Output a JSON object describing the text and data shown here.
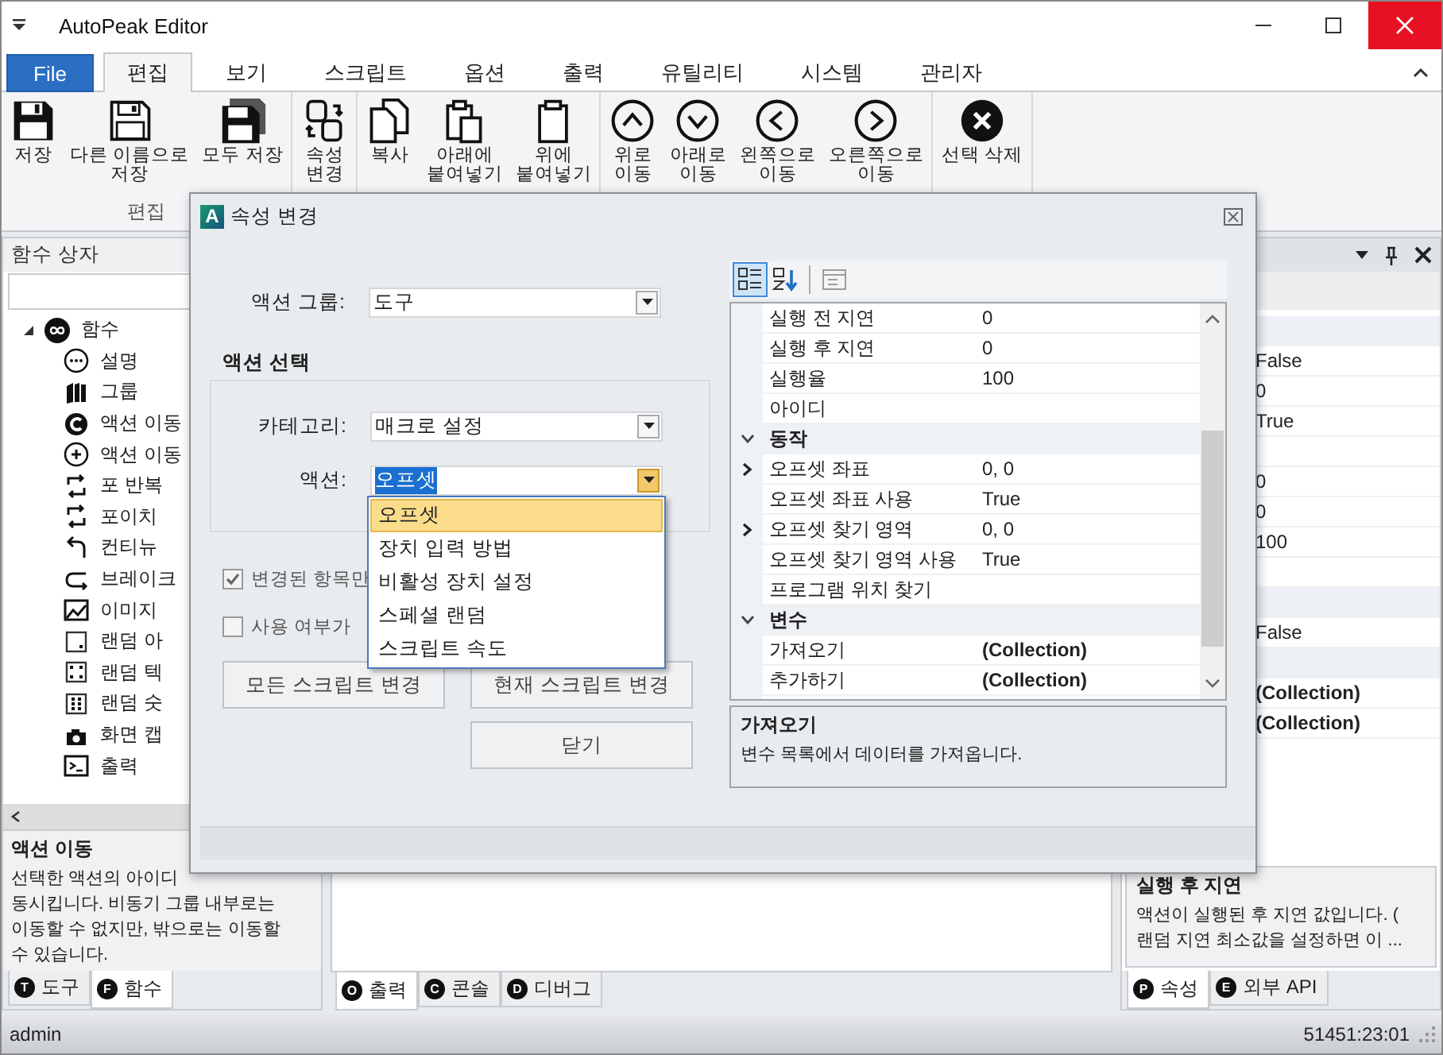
{
  "window": {
    "title": "AutoPeak Editor"
  },
  "ribbon_tabs": [
    {
      "label": "File",
      "kind": "file",
      "selected": false
    },
    {
      "label": "편집",
      "kind": "tab",
      "selected": true
    },
    {
      "label": "보기",
      "kind": "tab",
      "selected": false
    },
    {
      "label": "스크립트",
      "kind": "tab",
      "selected": false
    },
    {
      "label": "옵션",
      "kind": "tab",
      "selected": false
    },
    {
      "label": "출력",
      "kind": "tab",
      "selected": false
    },
    {
      "label": "유틸리티",
      "kind": "tab",
      "selected": false
    },
    {
      "label": "시스템",
      "kind": "tab",
      "selected": false
    },
    {
      "label": "관리자",
      "kind": "tab",
      "selected": false
    }
  ],
  "ribbon_groups": [
    {
      "label": "편집",
      "buttons": [
        {
          "kind": "save",
          "lines": [
            "저장"
          ]
        },
        {
          "kind": "save-as",
          "lines": [
            "다른 이름으로",
            "저장"
          ]
        },
        {
          "kind": "save-all",
          "lines": [
            "모두 저장"
          ]
        }
      ]
    },
    {
      "buttons": [
        {
          "kind": "swap",
          "lines": [
            "속성",
            "변경"
          ]
        }
      ]
    },
    {
      "buttons": [
        {
          "kind": "copy",
          "lines": [
            "복사"
          ]
        },
        {
          "kind": "paste-below",
          "lines": [
            "아래에",
            "붙여넣기"
          ]
        },
        {
          "kind": "paste-above",
          "lines": [
            "위에",
            "붙여넣기"
          ]
        }
      ]
    },
    {
      "buttons": [
        {
          "kind": "up",
          "lines": [
            "위로",
            "이동"
          ]
        },
        {
          "kind": "down",
          "lines": [
            "아래로",
            "이동"
          ]
        },
        {
          "kind": "left",
          "lines": [
            "왼쪽으로",
            "이동"
          ]
        },
        {
          "kind": "right",
          "lines": [
            "오른쪽으로",
            "이동"
          ]
        }
      ]
    },
    {
      "buttons": [
        {
          "kind": "delete",
          "lines": [
            "선택 삭제"
          ]
        }
      ]
    }
  ],
  "left_panel": {
    "title": "함수 상자",
    "tree": [
      {
        "label": "함수",
        "kind": "infinity",
        "expanded": true,
        "children": [
          {
            "label": "설명",
            "kind": "dots"
          },
          {
            "label": "그룹",
            "kind": "books"
          },
          {
            "label": "액션 이동",
            "kind": "c-filled"
          },
          {
            "label": "액션 이동",
            "kind": "plus-circle"
          },
          {
            "label": "포 반복",
            "kind": "loop"
          },
          {
            "label": "포이치",
            "kind": "loop"
          },
          {
            "label": "컨티뉴",
            "kind": "return"
          },
          {
            "label": "브레이크",
            "kind": "break"
          },
          {
            "label": "이미지",
            "kind": "image"
          },
          {
            "label": "랜덤 아",
            "kind": "dice-one"
          },
          {
            "label": "랜덤 텍",
            "kind": "dice-four"
          },
          {
            "label": "랜덤 숫",
            "kind": "dice-six"
          },
          {
            "label": "화면 캡",
            "kind": "camera"
          },
          {
            "label": "출력",
            "kind": "terminal"
          }
        ]
      }
    ],
    "description": {
      "title": "액션 이동",
      "lines": [
        "선택한 액션의 아이디",
        "동시킵니다. 비동기 그룹 내부로는",
        "이동할 수 없지만, 밖으로는 이동할",
        "수 있습니다."
      ]
    },
    "tabs": [
      {
        "letter": "T",
        "label": "도구",
        "selected": false
      },
      {
        "letter": "F",
        "label": "함수",
        "selected": true
      }
    ]
  },
  "center_panel": {
    "tabs": [
      {
        "letter": "O",
        "label": "출력",
        "selected": true
      },
      {
        "letter": "C",
        "label": "콘솔",
        "selected": false
      },
      {
        "letter": "D",
        "label": "디버그",
        "selected": false
      }
    ]
  },
  "right_panel": {
    "rows": [
      {
        "kind": "category"
      },
      {
        "kind": "property",
        "value": "False",
        "modified": false
      },
      {
        "kind": "property",
        "value": "0",
        "modified": false
      },
      {
        "kind": "property",
        "value": "True",
        "modified": false
      },
      {
        "kind": "property"
      },
      {
        "kind": "property",
        "value": "0",
        "modified": false
      },
      {
        "kind": "property",
        "value": "0",
        "modified": false
      },
      {
        "kind": "property",
        "value": "100",
        "modified": false
      },
      {
        "kind": "property"
      },
      {
        "kind": "category"
      },
      {
        "kind": "property",
        "value": "False",
        "modified": false
      },
      {
        "kind": "category"
      },
      {
        "kind": "property",
        "value": "(Collection)",
        "modified": true
      },
      {
        "kind": "property",
        "value": "(Collection)",
        "modified": true
      }
    ],
    "description": {
      "title": "실행 후 지연",
      "lines": [
        "액션이 실행된 후 지연 값입니다. (",
        "랜덤 지연 최소값을 설정하면 이 ..."
      ]
    },
    "tabs": [
      {
        "letter": "P",
        "label": "속성",
        "selected": true
      },
      {
        "letter": "E",
        "label": "외부 API",
        "selected": false
      }
    ]
  },
  "status_bar": {
    "user": "admin",
    "time": "51451:23:01"
  },
  "dialog": {
    "logo": "A",
    "title": "속성 변경",
    "fields": [
      {
        "label": "액션 그룹:",
        "value": "도구",
        "open": false
      }
    ],
    "group": {
      "title": "액션 선택",
      "fields": [
        {
          "label": "카테고리:",
          "value": "매크로 설정",
          "open": false
        },
        {
          "label": "액션:",
          "value": "오프셋",
          "open": true
        }
      ]
    },
    "dropdown": [
      {
        "label": "오프셋",
        "selected": true
      },
      {
        "label": "장치 입력 방법",
        "selected": false
      },
      {
        "label": "비활성 장치 설정",
        "selected": false
      },
      {
        "label": "스페셜 랜덤",
        "selected": false
      },
      {
        "label": "스크립트 속도",
        "selected": false
      }
    ],
    "checkboxes": [
      {
        "label": "변경된 항목만",
        "checked": true
      },
      {
        "label": "사용 여부가",
        "checked": false
      }
    ],
    "buttons": [
      "모든 스크립트 변경",
      "현재 스크립트 변경",
      "닫기"
    ],
    "property_grid": {
      "toolbar": [
        {
          "kind": "categorized",
          "selected": true,
          "disabled": false
        },
        {
          "kind": "alphabetical",
          "selected": false,
          "disabled": false
        },
        {
          "kind": "property-pages",
          "selected": false,
          "disabled": true
        }
      ],
      "rows": [
        {
          "kind": "property",
          "label": "실행 전 지연",
          "value": "0",
          "modified": false
        },
        {
          "kind": "property",
          "label": "실행 후 지연",
          "value": "0",
          "modified": false
        },
        {
          "kind": "property",
          "label": "실행율",
          "value": "100",
          "modified": false
        },
        {
          "kind": "property",
          "label": "아이디"
        },
        {
          "kind": "category",
          "label": "동작",
          "expanded": true
        },
        {
          "kind": "property",
          "label": "오프셋 좌표",
          "value": "0, 0",
          "modified": false,
          "expanded": false
        },
        {
          "kind": "property",
          "label": "오프셋 좌표 사용",
          "value": "True",
          "modified": false
        },
        {
          "kind": "property",
          "label": "오프셋 찾기 영역",
          "value": "0, 0",
          "modified": false,
          "expanded": false
        },
        {
          "kind": "property",
          "label": "오프셋 찾기 영역 사용",
          "value": "True",
          "modified": false
        },
        {
          "kind": "property",
          "label": "프로그램 위치 찾기"
        },
        {
          "kind": "category",
          "label": "변수",
          "expanded": true
        },
        {
          "kind": "property",
          "label": "가져오기",
          "value": "(Collection)",
          "modified": true
        },
        {
          "kind": "property",
          "label": "추가하기",
          "value": "(Collection)",
          "modified": true
        }
      ],
      "description": {
        "title": "가져오기",
        "text": "변수 목록에서 데이터를 가져옵니다."
      }
    }
  }
}
